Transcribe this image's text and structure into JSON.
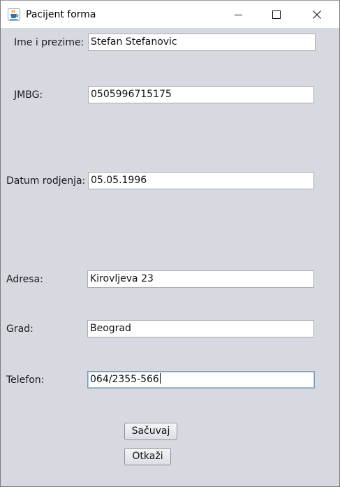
{
  "window": {
    "title": "Pacijent forma",
    "icon": "java-coffee-cup-icon"
  },
  "form": {
    "ime_label": "Ime i prezime:",
    "ime_value": "Stefan Stefanovic",
    "jmbg_label": "JMBG:",
    "jmbg_value": "0505996715175",
    "datum_label": "Datum rodjenja:",
    "datum_value": "05.05.1996",
    "adresa_label": "Adresa:",
    "adresa_value": "Kirovljeva 23",
    "grad_label": "Grad:",
    "grad_value": "Beograd",
    "telefon_label": "Telefon:",
    "telefon_value": "064/2355-566"
  },
  "buttons": {
    "save_label": "Sačuvaj",
    "cancel_label": "Otkaži"
  },
  "colors": {
    "background": "#d6d9df",
    "titlebar": "#ffffff",
    "focus_border": "#7d9ab8"
  }
}
